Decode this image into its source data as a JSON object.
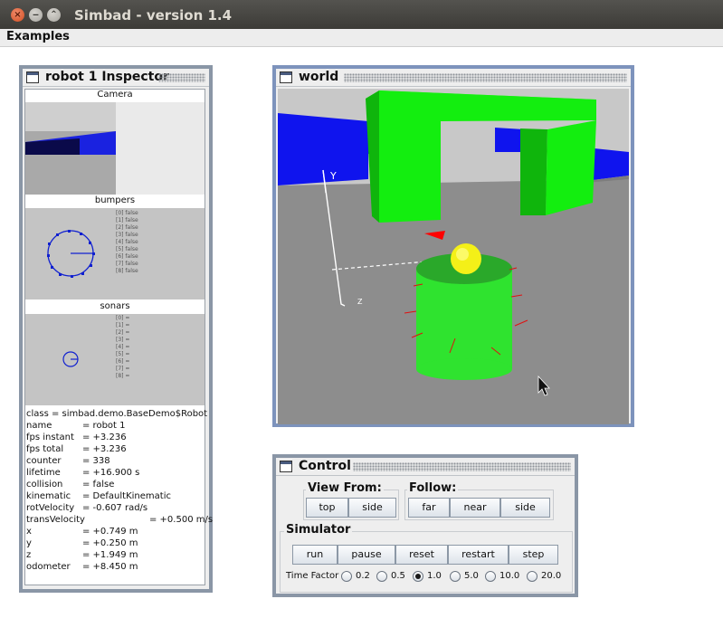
{
  "window": {
    "title": "Simbad  - version 1.4"
  },
  "menu": {
    "examples": "Examples"
  },
  "inspector": {
    "title": "robot 1 Inspector",
    "camera_label": "Camera",
    "bumpers_label": "bumpers",
    "bumpers": [
      "[0] false",
      "[1] false",
      "[2] false",
      "[3] false",
      "[4] false",
      "[5] false",
      "[6] false",
      "[7] false",
      "[8] false"
    ],
    "sonars_label": "sonars",
    "sonars": [
      "[0] =",
      "[1] =",
      "[2] =",
      "[3] =",
      "[4] =",
      "[5] =",
      "[6] =",
      "[7] =",
      "[8] ="
    ],
    "class_line": "class = simbad.demo.BaseDemo$Robot",
    "props": [
      {
        "k": "name",
        "v": "= robot 1"
      },
      {
        "k": "fps instant",
        "v": "= +3.236"
      },
      {
        "k": "fps total",
        "v": "= +3.236"
      },
      {
        "k": "counter",
        "v": "= 338"
      },
      {
        "k": "lifetime",
        "v": "= +16.900 s"
      },
      {
        "k": "collision",
        "v": "= false"
      },
      {
        "k": "kinematic",
        "v": "= DefaultKinematic"
      },
      {
        "k": "rotVelocity",
        "v": "= -0.607 rad/s"
      },
      {
        "k": "transVelocity",
        "v": "= +0.500 m/s"
      },
      {
        "k": "x",
        "v": "= +0.749 m"
      },
      {
        "k": "y",
        "v": "= +0.250 m"
      },
      {
        "k": "z",
        "v": "= +1.949 m"
      },
      {
        "k": "odometer",
        "v": "= +8.450 m"
      }
    ]
  },
  "world": {
    "title": "world",
    "axis_y": "Y",
    "axis_z": "Z",
    "colors": {
      "sky": "#c8c8c8",
      "floor": "#8d8d8d",
      "wall": "#0f14ee",
      "arch": "#13ee0f",
      "robot": "#2fe32f",
      "ball": "#f4f018",
      "marker": "#ff0000"
    }
  },
  "control": {
    "title": "Control",
    "view_from": {
      "label": "View From:",
      "top": "top",
      "side": "side"
    },
    "follow": {
      "label": "Follow:",
      "far": "far",
      "near": "near",
      "side": "side"
    },
    "simulator": {
      "label": "Simulator",
      "run": "run",
      "pause": "pause",
      "reset": "reset",
      "restart": "restart",
      "step": "step"
    },
    "time_factor": {
      "label": "Time Factor",
      "options": [
        "0.2",
        "0.5",
        "1.0",
        "5.0",
        "10.0",
        "20.0"
      ],
      "selected": "1.0"
    }
  }
}
